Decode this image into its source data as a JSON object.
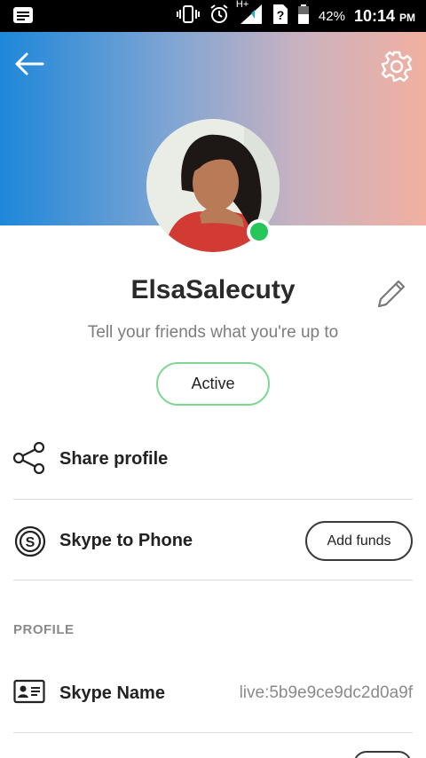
{
  "status_bar": {
    "battery_percent": "42%",
    "time": "10:14",
    "time_suffix": "PM",
    "network_label": "H+",
    "icons": [
      "message-icon",
      "vibrate-icon",
      "alarm-icon",
      "signal-icon",
      "sim-unknown-icon",
      "battery-icon"
    ]
  },
  "header": {
    "back_icon": "arrow-left-icon",
    "settings_icon": "gear-icon",
    "gradient_colors": [
      "#1e87d8",
      "#f2b0a0"
    ]
  },
  "profile": {
    "display_name": "ElsaSalecuty",
    "mood_placeholder": "Tell your friends what you're up to",
    "status_button": "Active",
    "presence_color": "#27c65a"
  },
  "actions": {
    "share_profile": "Share profile",
    "skype_to_phone": "Skype to Phone",
    "add_funds": "Add funds"
  },
  "profile_section": {
    "heading": "PROFILE",
    "skype_name_label": "Skype Name",
    "skype_name_value": "live:5b9e9ce9dc2d0a9f"
  }
}
